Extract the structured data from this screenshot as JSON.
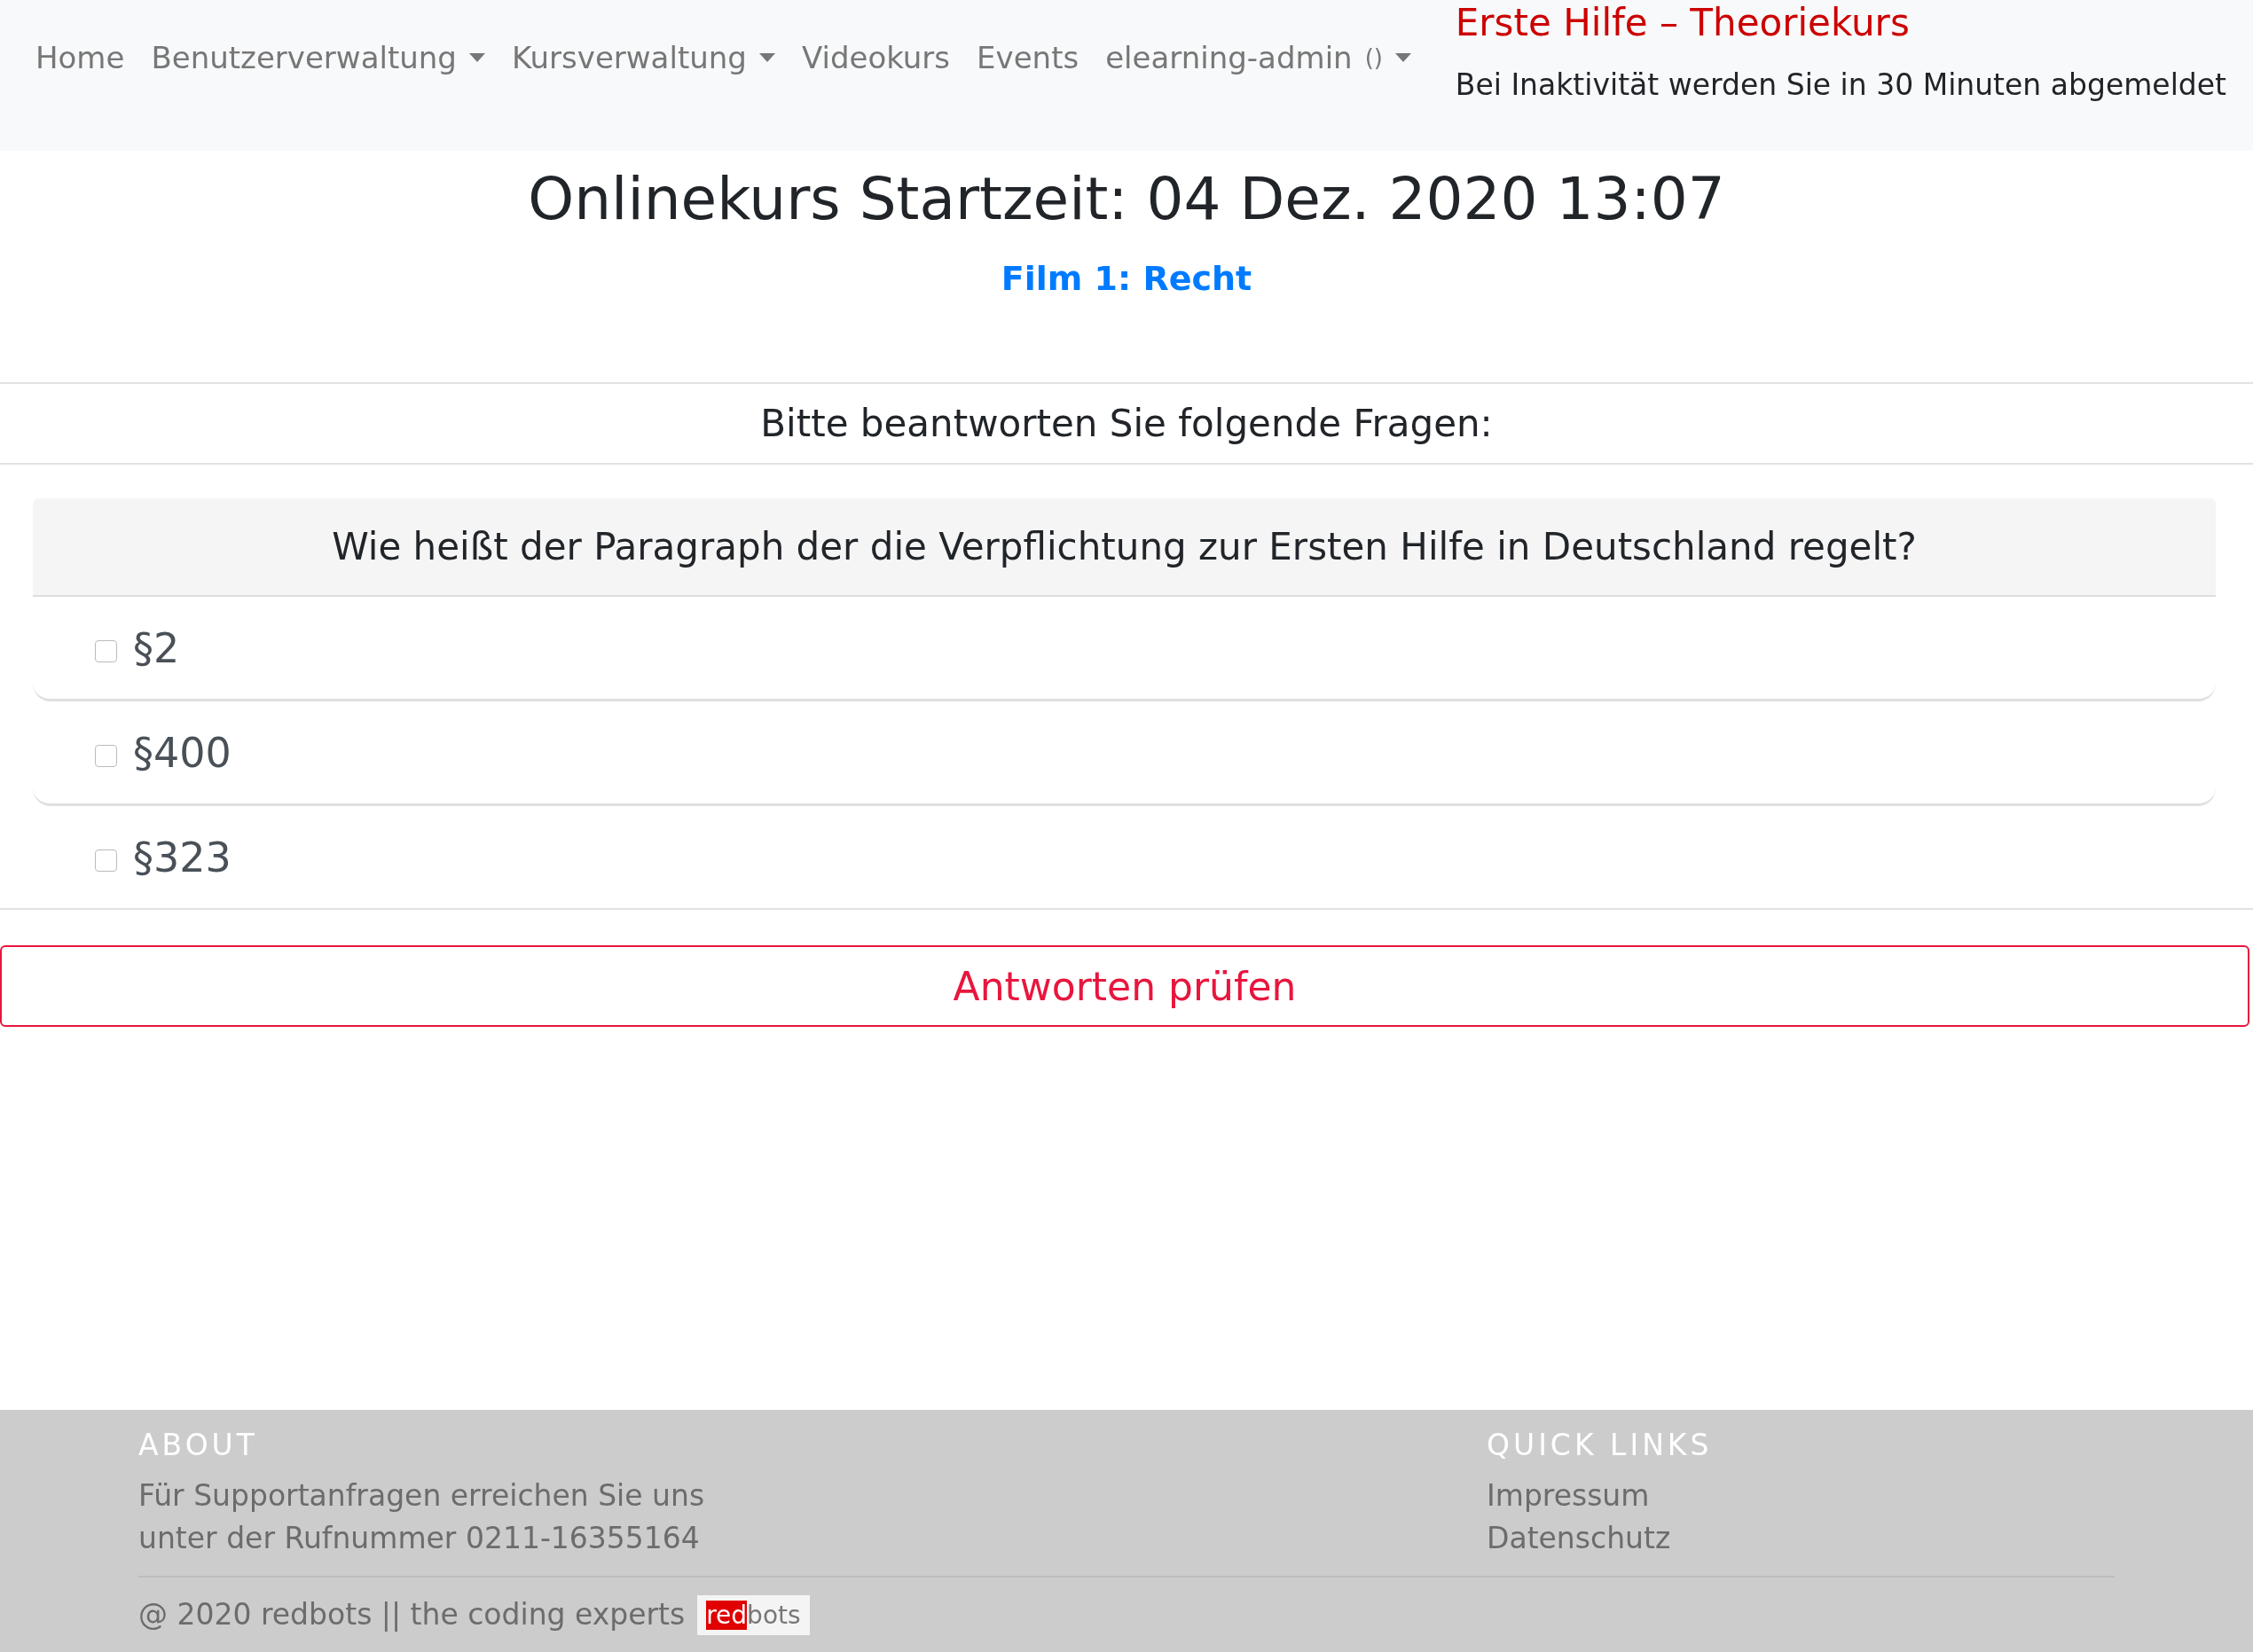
{
  "nav": {
    "items": [
      {
        "label": "Home",
        "dropdown": false
      },
      {
        "label": "Benutzerverwaltung",
        "dropdown": true
      },
      {
        "label": "Kursverwaltung",
        "dropdown": true
      },
      {
        "label": "Videokurs",
        "dropdown": false
      },
      {
        "label": "Events",
        "dropdown": false
      },
      {
        "label": "elearning-admin",
        "suffix": "()",
        "dropdown": true
      }
    ],
    "brand": "Erste Hilfe – Theoriekurs",
    "notice": "Bei Inaktivität werden Sie in 30 Minuten abgemeldet"
  },
  "heading": "Onlinekurs Startzeit: 04 Dez. 2020 13:07",
  "film_link": "Film 1: Recht",
  "quiz": {
    "header": "Bitte beantworten Sie folgende Fragen:",
    "question": "Wie heißt der Paragraph der die Verpflichtung zur Ersten Hilfe in Deutschland regelt?",
    "options": [
      {
        "label": "§2",
        "checked": false
      },
      {
        "label": "§400",
        "checked": false
      },
      {
        "label": "§323",
        "checked": false
      }
    ],
    "submit": "Antworten prüfen"
  },
  "footer": {
    "about_title": "ABOUT",
    "about_lines": [
      "Für Supportanfragen erreichen Sie uns",
      "unter der Rufnummer 0211-16355164"
    ],
    "links_title": "QUICK LINKS",
    "links": [
      "Impressum",
      "Datenschutz"
    ],
    "copyright": "@ 2020 redbots || the coding experts",
    "logo": {
      "highlight": "red",
      "rest": "bots"
    }
  }
}
